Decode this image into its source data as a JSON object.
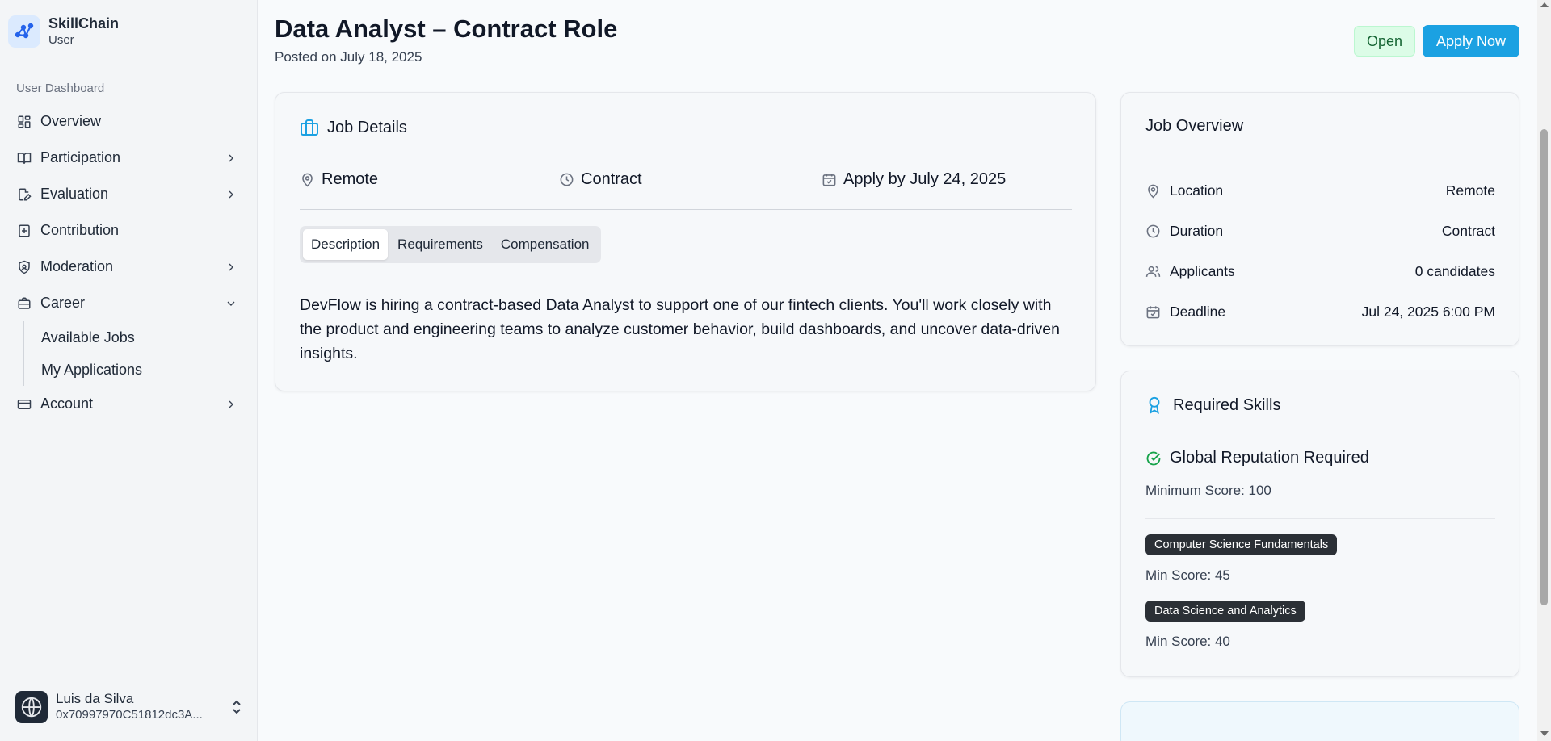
{
  "colors": {
    "accent": "#1ba1e2",
    "success": "#16a34a",
    "open_badge_bg": "#dcfce7",
    "tag_bg": "#2b3036"
  },
  "brand": {
    "name": "SkillChain",
    "role": "User",
    "icon": "skillchain-logo-icon"
  },
  "sidebar": {
    "section_label": "User Dashboard",
    "items": [
      {
        "label": "Overview",
        "icon": "grid-icon",
        "expandable": false
      },
      {
        "label": "Participation",
        "icon": "book-open-icon",
        "expandable": true,
        "expanded": false
      },
      {
        "label": "Evaluation",
        "icon": "file-edit-icon",
        "expandable": true,
        "expanded": false
      },
      {
        "label": "Contribution",
        "icon": "plus-square-icon",
        "expandable": false
      },
      {
        "label": "Moderation",
        "icon": "shield-icon",
        "expandable": true,
        "expanded": false
      },
      {
        "label": "Career",
        "icon": "briefcase-icon",
        "expandable": true,
        "expanded": true
      },
      {
        "label": "Account",
        "icon": "credit-card-icon",
        "expandable": true,
        "expanded": false
      }
    ],
    "career_subitems": [
      "Available Jobs",
      "My Applications"
    ]
  },
  "user": {
    "name": "Luis da Silva",
    "address": "0x70997970C51812dc3A..."
  },
  "header": {
    "title": "Data Analyst – Contract Role",
    "posted": "Posted on July 18, 2025",
    "status_badge": "Open",
    "apply_label": "Apply Now"
  },
  "job_details": {
    "heading": "Job Details",
    "location": "Remote",
    "type": "Contract",
    "apply_by": "Apply by July 24, 2025",
    "tabs": [
      "Description",
      "Requirements",
      "Compensation"
    ],
    "active_tab": "Description",
    "description": "DevFlow is hiring a contract-based Data Analyst to support one of our fintech clients. You'll work closely with the product and engineering teams to analyze customer behavior, build dashboards, and uncover data-driven insights."
  },
  "overview": {
    "heading": "Job Overview",
    "rows": [
      {
        "key": "Location",
        "value": "Remote",
        "icon": "map-pin-icon"
      },
      {
        "key": "Duration",
        "value": "Contract",
        "icon": "clock-icon"
      },
      {
        "key": "Applicants",
        "value": "0 candidates",
        "icon": "users-icon"
      },
      {
        "key": "Deadline",
        "value": "Jul 24, 2025 6:00 PM",
        "icon": "calendar-icon"
      }
    ]
  },
  "skills": {
    "heading": "Required Skills",
    "global_label": "Global Reputation Required",
    "global_min": "Minimum Score: 100",
    "items": [
      {
        "name": "Computer Science Fundamentals",
        "min": "Min Score: 45"
      },
      {
        "name": "Data Science and Analytics",
        "min": "Min Score: 40"
      }
    ]
  }
}
